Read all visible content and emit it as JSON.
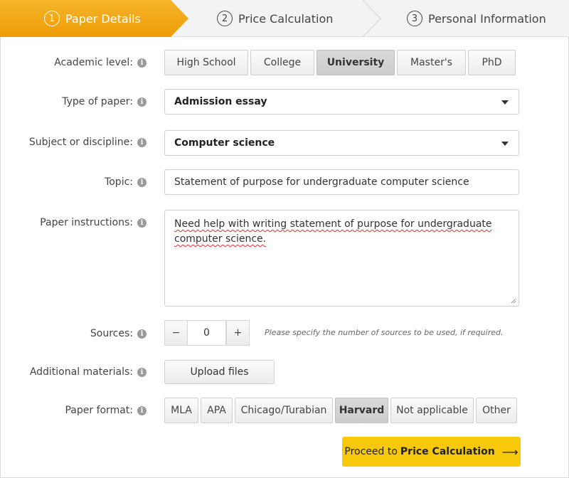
{
  "steps": [
    {
      "num": "1",
      "label": "Paper Details",
      "active": true
    },
    {
      "num": "2",
      "label": "Price Calculation",
      "active": false
    },
    {
      "num": "3",
      "label": "Personal Information",
      "active": false
    }
  ],
  "colors": {
    "accent": "#f0a30a",
    "button": "#f8c90a"
  },
  "form": {
    "academic_level": {
      "label": "Academic level:",
      "options": [
        "High School",
        "College",
        "University",
        "Master's",
        "PhD"
      ],
      "selected": "University"
    },
    "type_of_paper": {
      "label": "Type of paper:",
      "value": "Admission essay"
    },
    "subject": {
      "label": "Subject or discipline:",
      "value": "Computer science"
    },
    "topic": {
      "label": "Topic:",
      "value": "Statement of purpose for undergraduate computer science"
    },
    "instructions": {
      "label": "Paper instructions:",
      "value": "Need help with writing statement of purpose for undergraduate computer science."
    },
    "sources": {
      "label": "Sources:",
      "minus": "−",
      "value": "0",
      "plus": "+",
      "hint": "Please specify the number of sources to be used, if required."
    },
    "materials": {
      "label": "Additional materials:",
      "button": "Upload files"
    },
    "paper_format": {
      "label": "Paper format:",
      "options": [
        "MLA",
        "APA",
        "Chicago/Turabian",
        "Harvard",
        "Not applicable",
        "Other"
      ],
      "selected": "Harvard"
    }
  },
  "proceed": {
    "prefix": "Proceed to",
    "bold": "Price Calculation",
    "arrow": "⟶"
  },
  "icons": {
    "info": "i"
  }
}
